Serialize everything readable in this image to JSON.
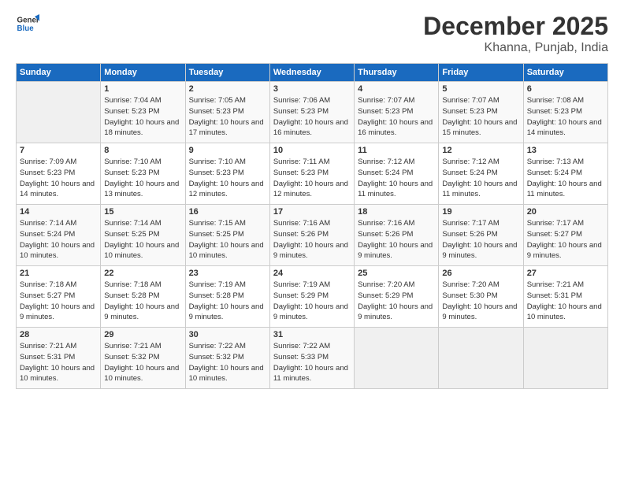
{
  "logo": {
    "line1": "General",
    "line2": "Blue"
  },
  "title": "December 2025",
  "location": "Khanna, Punjab, India",
  "days_header": [
    "Sunday",
    "Monday",
    "Tuesday",
    "Wednesday",
    "Thursday",
    "Friday",
    "Saturday"
  ],
  "weeks": [
    [
      {
        "day": "",
        "sunrise": "",
        "sunset": "",
        "daylight": ""
      },
      {
        "day": "1",
        "sunrise": "Sunrise: 7:04 AM",
        "sunset": "Sunset: 5:23 PM",
        "daylight": "Daylight: 10 hours and 18 minutes."
      },
      {
        "day": "2",
        "sunrise": "Sunrise: 7:05 AM",
        "sunset": "Sunset: 5:23 PM",
        "daylight": "Daylight: 10 hours and 17 minutes."
      },
      {
        "day": "3",
        "sunrise": "Sunrise: 7:06 AM",
        "sunset": "Sunset: 5:23 PM",
        "daylight": "Daylight: 10 hours and 16 minutes."
      },
      {
        "day": "4",
        "sunrise": "Sunrise: 7:07 AM",
        "sunset": "Sunset: 5:23 PM",
        "daylight": "Daylight: 10 hours and 16 minutes."
      },
      {
        "day": "5",
        "sunrise": "Sunrise: 7:07 AM",
        "sunset": "Sunset: 5:23 PM",
        "daylight": "Daylight: 10 hours and 15 minutes."
      },
      {
        "day": "6",
        "sunrise": "Sunrise: 7:08 AM",
        "sunset": "Sunset: 5:23 PM",
        "daylight": "Daylight: 10 hours and 14 minutes."
      }
    ],
    [
      {
        "day": "7",
        "sunrise": "Sunrise: 7:09 AM",
        "sunset": "Sunset: 5:23 PM",
        "daylight": "Daylight: 10 hours and 14 minutes."
      },
      {
        "day": "8",
        "sunrise": "Sunrise: 7:10 AM",
        "sunset": "Sunset: 5:23 PM",
        "daylight": "Daylight: 10 hours and 13 minutes."
      },
      {
        "day": "9",
        "sunrise": "Sunrise: 7:10 AM",
        "sunset": "Sunset: 5:23 PM",
        "daylight": "Daylight: 10 hours and 12 minutes."
      },
      {
        "day": "10",
        "sunrise": "Sunrise: 7:11 AM",
        "sunset": "Sunset: 5:23 PM",
        "daylight": "Daylight: 10 hours and 12 minutes."
      },
      {
        "day": "11",
        "sunrise": "Sunrise: 7:12 AM",
        "sunset": "Sunset: 5:24 PM",
        "daylight": "Daylight: 10 hours and 11 minutes."
      },
      {
        "day": "12",
        "sunrise": "Sunrise: 7:12 AM",
        "sunset": "Sunset: 5:24 PM",
        "daylight": "Daylight: 10 hours and 11 minutes."
      },
      {
        "day": "13",
        "sunrise": "Sunrise: 7:13 AM",
        "sunset": "Sunset: 5:24 PM",
        "daylight": "Daylight: 10 hours and 11 minutes."
      }
    ],
    [
      {
        "day": "14",
        "sunrise": "Sunrise: 7:14 AM",
        "sunset": "Sunset: 5:24 PM",
        "daylight": "Daylight: 10 hours and 10 minutes."
      },
      {
        "day": "15",
        "sunrise": "Sunrise: 7:14 AM",
        "sunset": "Sunset: 5:25 PM",
        "daylight": "Daylight: 10 hours and 10 minutes."
      },
      {
        "day": "16",
        "sunrise": "Sunrise: 7:15 AM",
        "sunset": "Sunset: 5:25 PM",
        "daylight": "Daylight: 10 hours and 10 minutes."
      },
      {
        "day": "17",
        "sunrise": "Sunrise: 7:16 AM",
        "sunset": "Sunset: 5:26 PM",
        "daylight": "Daylight: 10 hours and 9 minutes."
      },
      {
        "day": "18",
        "sunrise": "Sunrise: 7:16 AM",
        "sunset": "Sunset: 5:26 PM",
        "daylight": "Daylight: 10 hours and 9 minutes."
      },
      {
        "day": "19",
        "sunrise": "Sunrise: 7:17 AM",
        "sunset": "Sunset: 5:26 PM",
        "daylight": "Daylight: 10 hours and 9 minutes."
      },
      {
        "day": "20",
        "sunrise": "Sunrise: 7:17 AM",
        "sunset": "Sunset: 5:27 PM",
        "daylight": "Daylight: 10 hours and 9 minutes."
      }
    ],
    [
      {
        "day": "21",
        "sunrise": "Sunrise: 7:18 AM",
        "sunset": "Sunset: 5:27 PM",
        "daylight": "Daylight: 10 hours and 9 minutes."
      },
      {
        "day": "22",
        "sunrise": "Sunrise: 7:18 AM",
        "sunset": "Sunset: 5:28 PM",
        "daylight": "Daylight: 10 hours and 9 minutes."
      },
      {
        "day": "23",
        "sunrise": "Sunrise: 7:19 AM",
        "sunset": "Sunset: 5:28 PM",
        "daylight": "Daylight: 10 hours and 9 minutes."
      },
      {
        "day": "24",
        "sunrise": "Sunrise: 7:19 AM",
        "sunset": "Sunset: 5:29 PM",
        "daylight": "Daylight: 10 hours and 9 minutes."
      },
      {
        "day": "25",
        "sunrise": "Sunrise: 7:20 AM",
        "sunset": "Sunset: 5:29 PM",
        "daylight": "Daylight: 10 hours and 9 minutes."
      },
      {
        "day": "26",
        "sunrise": "Sunrise: 7:20 AM",
        "sunset": "Sunset: 5:30 PM",
        "daylight": "Daylight: 10 hours and 9 minutes."
      },
      {
        "day": "27",
        "sunrise": "Sunrise: 7:21 AM",
        "sunset": "Sunset: 5:31 PM",
        "daylight": "Daylight: 10 hours and 10 minutes."
      }
    ],
    [
      {
        "day": "28",
        "sunrise": "Sunrise: 7:21 AM",
        "sunset": "Sunset: 5:31 PM",
        "daylight": "Daylight: 10 hours and 10 minutes."
      },
      {
        "day": "29",
        "sunrise": "Sunrise: 7:21 AM",
        "sunset": "Sunset: 5:32 PM",
        "daylight": "Daylight: 10 hours and 10 minutes."
      },
      {
        "day": "30",
        "sunrise": "Sunrise: 7:22 AM",
        "sunset": "Sunset: 5:32 PM",
        "daylight": "Daylight: 10 hours and 10 minutes."
      },
      {
        "day": "31",
        "sunrise": "Sunrise: 7:22 AM",
        "sunset": "Sunset: 5:33 PM",
        "daylight": "Daylight: 10 hours and 11 minutes."
      },
      {
        "day": "",
        "sunrise": "",
        "sunset": "",
        "daylight": ""
      },
      {
        "day": "",
        "sunrise": "",
        "sunset": "",
        "daylight": ""
      },
      {
        "day": "",
        "sunrise": "",
        "sunset": "",
        "daylight": ""
      }
    ]
  ]
}
